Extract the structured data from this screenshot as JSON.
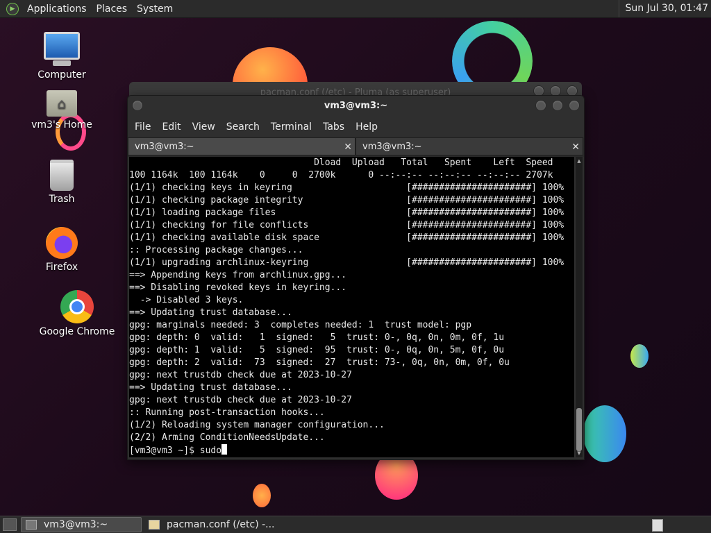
{
  "top_panel": {
    "menus": [
      "Applications",
      "Places",
      "System"
    ],
    "clock": "Sun Jul 30, 01:47"
  },
  "desktop_icons": [
    {
      "label": "Computer",
      "icon": "computer-icon"
    },
    {
      "label": "vm3's Home",
      "icon": "home-folder-icon"
    },
    {
      "label": "Trash",
      "icon": "trash-icon"
    },
    {
      "label": "Firefox",
      "icon": "firefox-icon"
    },
    {
      "label": "Google Chrome",
      "icon": "chrome-icon"
    }
  ],
  "background_window": {
    "title": "pacman.conf (/etc) - Pluma (as superuser)"
  },
  "terminal": {
    "title": "vm3@vm3:~",
    "menu": [
      "File",
      "Edit",
      "View",
      "Search",
      "Terminal",
      "Tabs",
      "Help"
    ],
    "tabs": [
      {
        "label": "vm3@vm3:~",
        "active": true
      },
      {
        "label": "vm3@vm3:~",
        "active": false
      }
    ],
    "lines": [
      "                                  Dload  Upload   Total   Spent    Left  Speed",
      "100 1164k  100 1164k    0     0  2700k      0 --:--:-- --:--:-- --:--:-- 2707k",
      "(1/1) checking keys in keyring                     [######################] 100%",
      "(1/1) checking package integrity                   [######################] 100%",
      "(1/1) loading package files                        [######################] 100%",
      "(1/1) checking for file conflicts                  [######################] 100%",
      "(1/1) checking available disk space                [######################] 100%",
      ":: Processing package changes...",
      "(1/1) upgrading archlinux-keyring                  [######################] 100%",
      "==> Appending keys from archlinux.gpg...",
      "==> Disabling revoked keys in keyring...",
      "  -> Disabled 3 keys.",
      "==> Updating trust database...",
      "gpg: marginals needed: 3  completes needed: 1  trust model: pgp",
      "gpg: depth: 0  valid:   1  signed:   5  trust: 0-, 0q, 0n, 0m, 0f, 1u",
      "gpg: depth: 1  valid:   5  signed:  95  trust: 0-, 0q, 0n, 5m, 0f, 0u",
      "gpg: depth: 2  valid:  73  signed:  27  trust: 73-, 0q, 0n, 0m, 0f, 0u",
      "gpg: next trustdb check due at 2023-10-27",
      "==> Updating trust database...",
      "gpg: next trustdb check due at 2023-10-27",
      ":: Running post-transaction hooks...",
      "(1/2) Reloading system manager configuration...",
      "(2/2) Arming ConditionNeedsUpdate..."
    ],
    "prompt": "[vm3@vm3 ~]$ sudo"
  },
  "taskbar": {
    "tasks": [
      {
        "label": "vm3@vm3:~",
        "active": true
      },
      {
        "label": "pacman.conf (/etc) -...",
        "active": false
      }
    ]
  }
}
